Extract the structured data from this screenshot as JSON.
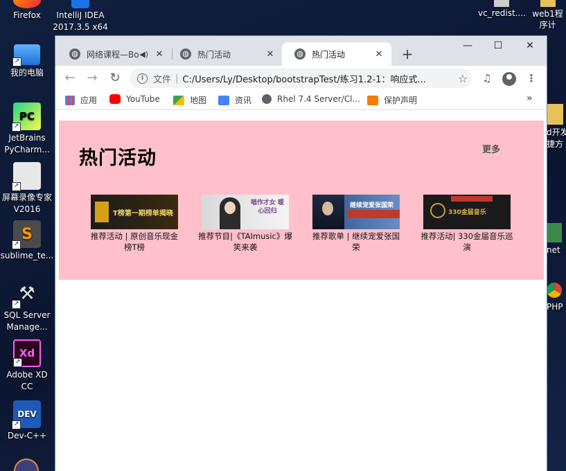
{
  "desktop": {
    "left_icons": [
      {
        "label": "Firefox"
      },
      {
        "label": "IntelliJ IDEA 2017.3.5 x64"
      },
      {
        "label": "我的电脑"
      },
      {
        "label": "JetBrains PyCharm..."
      },
      {
        "label": "屏幕录像专家 V2016"
      },
      {
        "label": "sublime_te..."
      },
      {
        "label": "SQL Server Manage..."
      },
      {
        "label": "Adobe XD CC"
      },
      {
        "label": "Dev-C++"
      }
    ],
    "right_icons": [
      {
        "label": "vc_redist...."
      },
      {
        "label": "web1程序计"
      },
      {
        "label": "d开发"
      },
      {
        "label": "捷方"
      },
      {
        "label": "net"
      },
      {
        "label": "PHP"
      }
    ]
  },
  "browser": {
    "tabs": [
      {
        "title": "网络课程—Bo",
        "active": false,
        "has_sound": true
      },
      {
        "title": "热门活动",
        "active": false,
        "has_sound": false
      },
      {
        "title": "热门活动",
        "active": true,
        "has_sound": false
      }
    ],
    "new_tab_glyph": "+",
    "window_controls": {
      "minimize": "—",
      "maximize": "☐",
      "close": "✕"
    },
    "omnibox": {
      "scheme_label": "文件",
      "separator": "|",
      "url": "C:/Users/Ly/Desktop/bootstrapTest/练习1.2-1：响应式..."
    },
    "bookmarks": [
      {
        "label": "应用",
        "icon": "apps-grid-icon",
        "color": "#e8453c"
      },
      {
        "label": "YouTube",
        "icon": "youtube-icon",
        "color": "#ff0000"
      },
      {
        "label": "地图",
        "icon": "maps-icon",
        "color": "#34a853"
      },
      {
        "label": "资讯",
        "icon": "news-icon",
        "color": "#4285f4"
      },
      {
        "label": "Rhel 7.4 Server/Cl...",
        "icon": "globe-icon",
        "color": "#5f6368"
      },
      {
        "label": "保护声明",
        "icon": "security-icon",
        "color": "#f57c00"
      }
    ],
    "bookmarks_overflow": "»"
  },
  "page": {
    "panel_color": "#ffc0cb",
    "title": "热门活动",
    "more_link": "更多",
    "cards": [
      {
        "caption": "推荐活动 | 原创音乐现金榜T榜",
        "thumb_text": "T榜第一期榜单揭晓"
      },
      {
        "caption": "推荐节目|《TAImusic》爆笑来袭",
        "thumb_text": "唱作才女 暖心回归"
      },
      {
        "caption": "推荐歌单 | 继续宠爱张国荣",
        "thumb_text": "继续宠爱张国荣"
      },
      {
        "caption": "推荐活动| 330金届音乐巡演",
        "thumb_text": "330金届音乐"
      }
    ]
  }
}
